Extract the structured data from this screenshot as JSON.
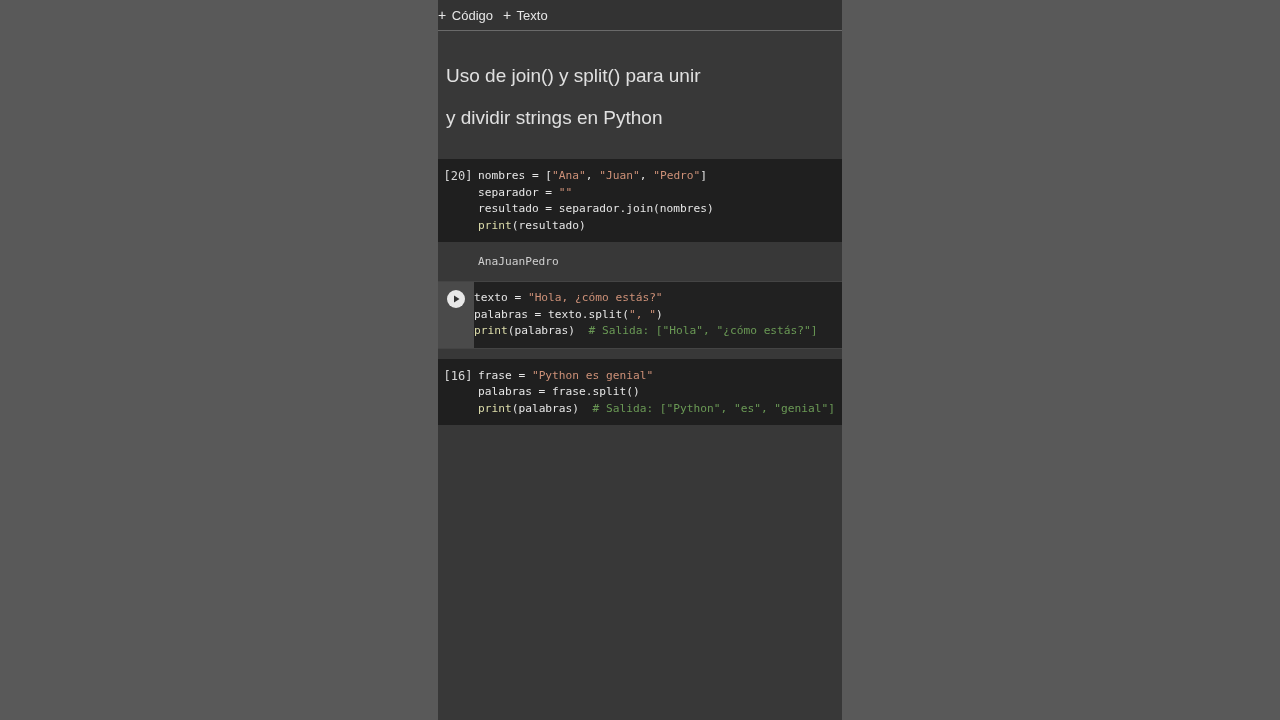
{
  "toolbar": {
    "buttons": [
      {
        "icon": "+",
        "label": "Código"
      },
      {
        "icon": "+",
        "label": "Texto"
      }
    ]
  },
  "heading": {
    "lines": [
      "Uso de join() y split() para unir",
      "y dividir strings en Python"
    ]
  },
  "cells": [
    {
      "kind": "code",
      "count": "[20]",
      "focused": false,
      "lines": [
        [
          {
            "kind": "plain",
            "s": "nombres = ["
          },
          {
            "kind": "string",
            "s": "\"Ana\""
          },
          {
            "kind": "plain",
            "s": ", "
          },
          {
            "kind": "string",
            "s": "\"Juan\""
          },
          {
            "kind": "plain",
            "s": ", "
          },
          {
            "kind": "string",
            "s": "\"Pedro\""
          },
          {
            "kind": "plain",
            "s": "]"
          }
        ],
        [
          {
            "kind": "plain",
            "s": "separador = "
          },
          {
            "kind": "string",
            "s": "\"\""
          }
        ],
        [
          {
            "kind": "plain",
            "s": "resultado = separador.join(nombres)"
          }
        ],
        [
          {
            "kind": "builtin",
            "s": "print"
          },
          {
            "kind": "plain",
            "s": "(resultado)"
          }
        ]
      ],
      "output": "AnaJuanPedro"
    },
    {
      "kind": "code",
      "focused": true,
      "lines": [
        [
          {
            "kind": "plain",
            "s": "texto = "
          },
          {
            "kind": "string",
            "s": "\"Hola, ¿cómo estás?\""
          }
        ],
        [
          {
            "kind": "plain",
            "s": "palabras = texto.split("
          },
          {
            "kind": "string",
            "s": "\", \""
          },
          {
            "kind": "plain",
            "s": ")"
          }
        ],
        [
          {
            "kind": "builtin",
            "s": "print"
          },
          {
            "kind": "plain",
            "s": "(palabras)  "
          },
          {
            "kind": "comment",
            "s": "# Salida: [\"Hola\", \"¿cómo estás?\"]"
          }
        ]
      ]
    },
    {
      "kind": "code",
      "count": "[16]",
      "focused": false,
      "lines": [
        [
          {
            "kind": "plain",
            "s": "frase = "
          },
          {
            "kind": "string",
            "s": "\"Python es genial\""
          }
        ],
        [
          {
            "kind": "plain",
            "s": "palabras = frase.split()"
          }
        ],
        [
          {
            "kind": "builtin",
            "s": "print"
          },
          {
            "kind": "plain",
            "s": "(palabras)  "
          },
          {
            "kind": "comment",
            "s": "# Salida: [\"Python\", \"es\", \"genial\"]"
          }
        ]
      ]
    }
  ]
}
